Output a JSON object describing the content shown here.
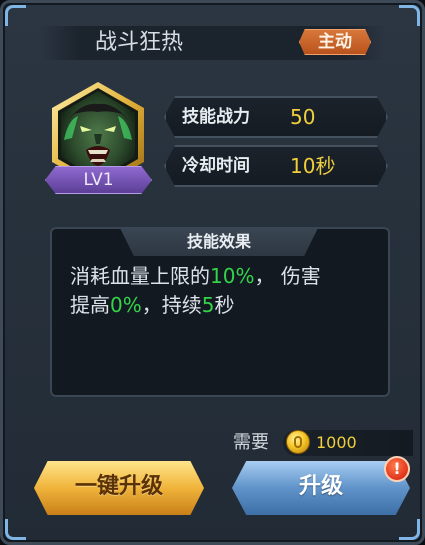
{
  "header": {
    "title": "战斗狂热",
    "type_badge": "主动"
  },
  "skill": {
    "portrait_icon": "demon-warrior-portrait-icon",
    "level": "LV1",
    "stats": [
      {
        "label": "技能战力",
        "value": "50"
      },
      {
        "label": "冷却时间",
        "value": "10秒"
      }
    ]
  },
  "effect": {
    "title": "技能效果",
    "segments": [
      "消耗血量上限的",
      "10%",
      "，  伤害",
      "提高",
      "0%",
      "，持续",
      "5",
      "秒"
    ]
  },
  "requirement": {
    "label": "需要",
    "icon": "gold-coin-icon",
    "value": "1000"
  },
  "buttons": {
    "one_key_upgrade": "一键升级",
    "upgrade": "升级",
    "alert_icon": "!"
  },
  "colors": {
    "highlight_green": "#33d44a",
    "value_yellow": "#f0cf3c",
    "badge_orange": "#c9622a",
    "level_purple": "#7553b3"
  }
}
